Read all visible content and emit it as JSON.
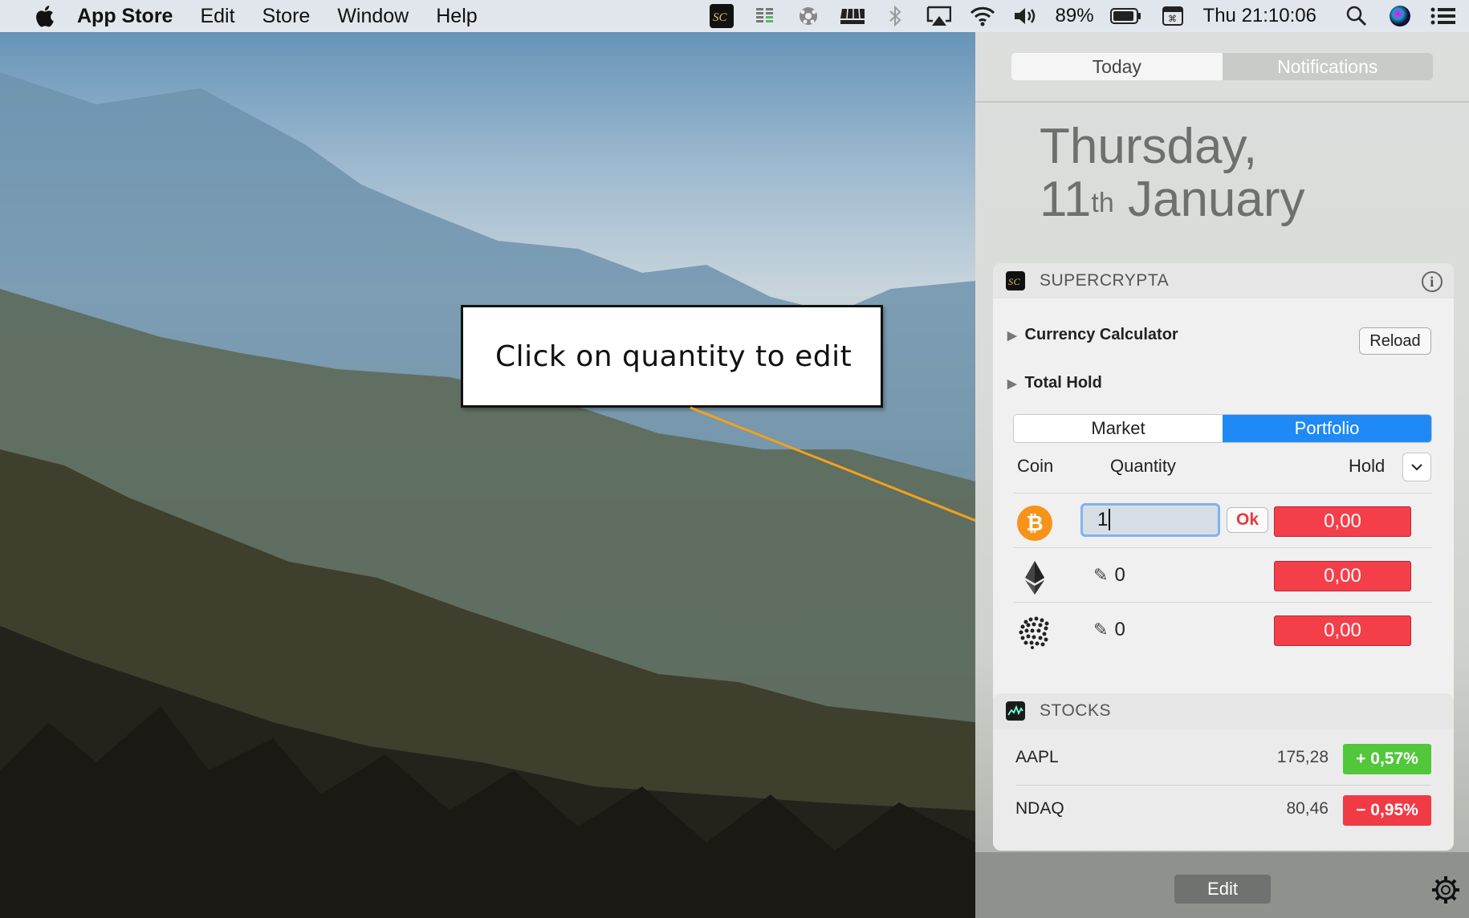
{
  "menubar": {
    "app_name": "App Store",
    "items": [
      "Edit",
      "Store",
      "Window",
      "Help"
    ],
    "battery": "89%",
    "clock": "Thu 21:10:06",
    "status_icons": [
      "supercrypta-icon",
      "istat-icon",
      "ball-icon",
      "dock-icon",
      "bluetooth-icon",
      "airplay-icon",
      "wifi-icon",
      "volume-icon",
      "battery-icon",
      "keyboard-icon",
      "spotlight-icon",
      "siri-icon",
      "notification-center-icon"
    ]
  },
  "panel": {
    "tabs": [
      "Today",
      "Notifications"
    ],
    "date_line1": "Thursday,",
    "date_day": "11",
    "date_suffix": "th",
    "date_month": "January",
    "bottom_edit": "Edit"
  },
  "supercrypta": {
    "title": "SUPERCRYPTA",
    "currency_calculator": "Currency Calculator",
    "total_hold": "Total Hold",
    "reload": "Reload",
    "segments": [
      "Market",
      "Portfolio"
    ],
    "selected_segment": "Portfolio",
    "col_coin": "Coin",
    "col_quantity": "Quantity",
    "col_hold": "Hold",
    "rows": [
      {
        "coin": "bitcoin",
        "quantity": "1",
        "editing": true,
        "ok": "Ok",
        "hold": "0,00"
      },
      {
        "coin": "ethereum",
        "quantity": "0",
        "editing": false,
        "hold": "0,00"
      },
      {
        "coin": "iota",
        "quantity": "0",
        "editing": false,
        "hold": "0,00"
      }
    ]
  },
  "stocks": {
    "title": "STOCKS",
    "rows": [
      {
        "symbol": "AAPL",
        "price": "175,28",
        "change": "+ 0,57%",
        "direction": "up"
      },
      {
        "symbol": "NDAQ",
        "price": "80,46",
        "change": "− 0,95%",
        "direction": "down"
      }
    ]
  },
  "callout": {
    "text": "Click on quantity to edit"
  },
  "colors": {
    "accent": "#1f8af5",
    "hold_red": "#f43f4a",
    "up_green": "#52c73a",
    "down_red": "#f03b45",
    "arrow_orange": "#f5a01a"
  }
}
